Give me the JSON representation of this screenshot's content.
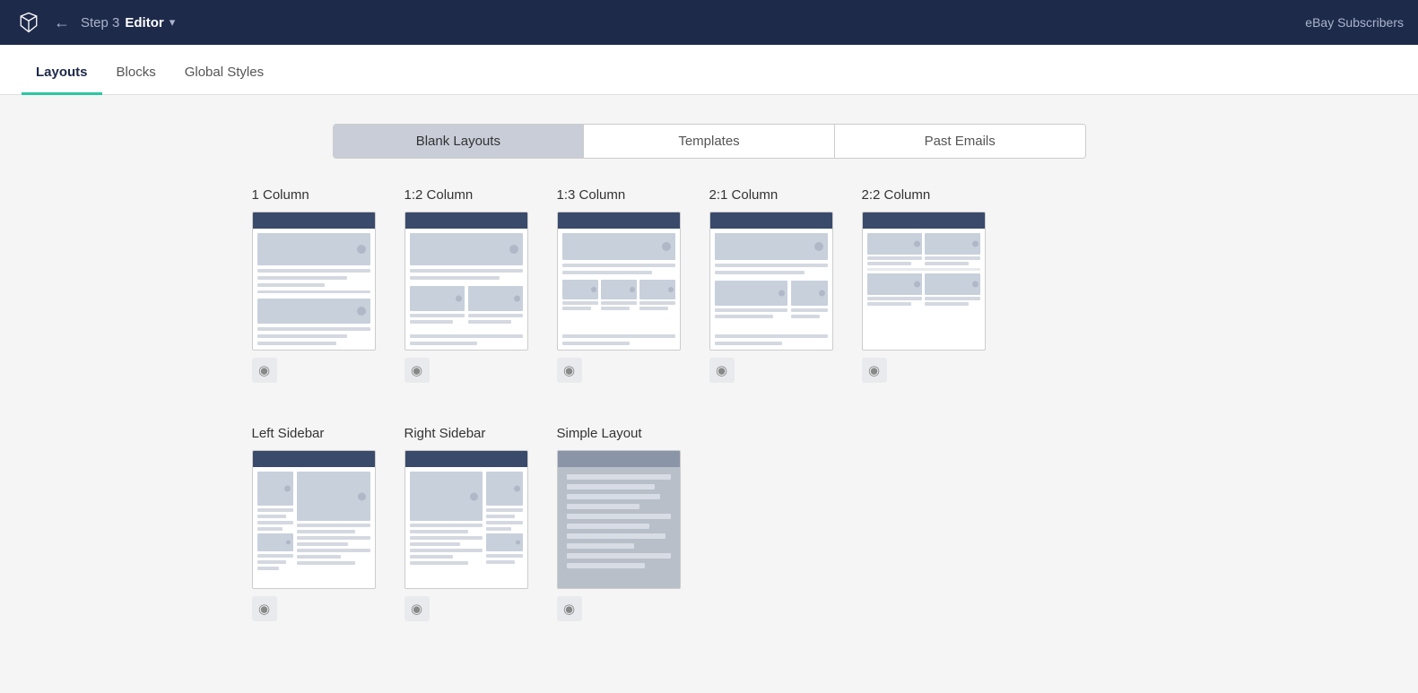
{
  "topbar": {
    "step_label": "Step 3",
    "editor_label": "Editor",
    "back_icon": "←",
    "chevron_icon": "▾",
    "campaign_name": "eBay Subscribers"
  },
  "secondnav": {
    "tabs": [
      {
        "id": "layouts",
        "label": "Layouts",
        "active": true
      },
      {
        "id": "blocks",
        "label": "Blocks",
        "active": false
      },
      {
        "id": "global-styles",
        "label": "Global Styles",
        "active": false
      }
    ]
  },
  "subtabs": {
    "tabs": [
      {
        "id": "blank-layouts",
        "label": "Blank Layouts",
        "active": true
      },
      {
        "id": "templates",
        "label": "Templates",
        "active": false
      },
      {
        "id": "past-emails",
        "label": "Past Emails",
        "active": false
      }
    ]
  },
  "layouts_row1": [
    {
      "id": "1col",
      "label": "1 Column"
    },
    {
      "id": "1-2col",
      "label": "1:2 Column"
    },
    {
      "id": "1-3col",
      "label": "1:3 Column"
    },
    {
      "id": "2-1col",
      "label": "2:1 Column"
    },
    {
      "id": "2-2col",
      "label": "2:2 Column"
    }
  ],
  "layouts_row2": [
    {
      "id": "left-sidebar",
      "label": "Left Sidebar"
    },
    {
      "id": "right-sidebar",
      "label": "Right Sidebar"
    },
    {
      "id": "simple-layout",
      "label": "Simple Layout"
    }
  ],
  "preview_icon": "👁",
  "eye_unicode": "◉"
}
